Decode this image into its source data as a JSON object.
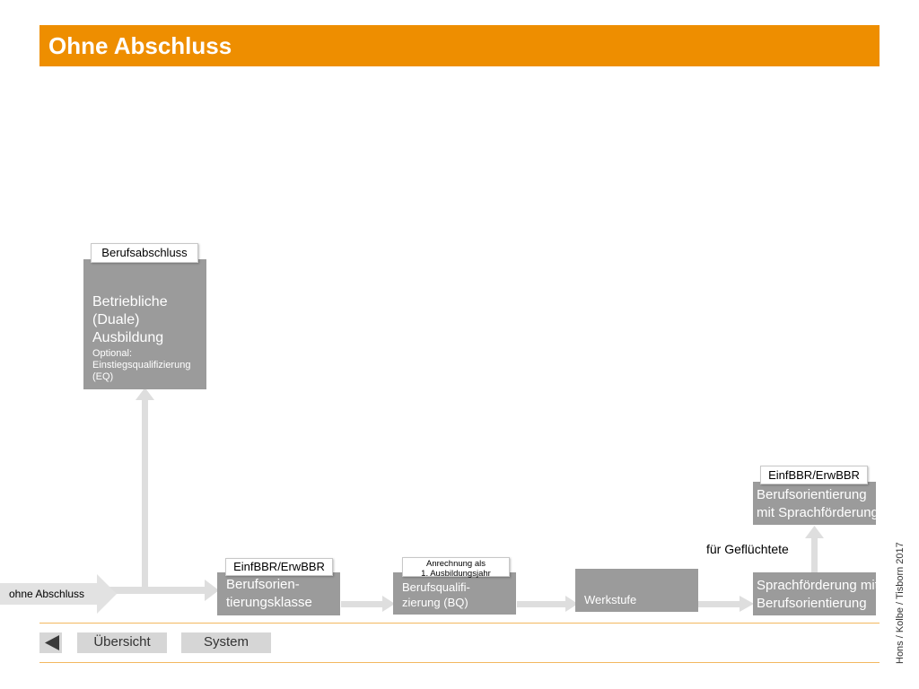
{
  "title": "Ohne Abschluss",
  "left_label": "ohne Abschluss",
  "boxes": {
    "duale": {
      "tag": "Berufsabschluss",
      "title_lines": [
        "Betriebliche",
        "(Duale)",
        "Ausbildung"
      ],
      "note_lines": [
        "Optional:",
        "Einstiegsqualifizierung",
        "(EQ)"
      ]
    },
    "bok": {
      "tag": "EinfBBR/ErwBBR",
      "lines": [
        "Berufsorien-",
        "tierungsklasse"
      ]
    },
    "bq": {
      "tag_lines": [
        "Anrechnung als",
        "1. Ausbildungsjahr"
      ],
      "lines": [
        "Berufsqualifi-",
        "zierung (BQ)"
      ]
    },
    "werkstufe": {
      "label": "Werkstufe"
    },
    "sprach": {
      "lines": [
        "Sprachförderung mit",
        "Berufsorientierung"
      ]
    },
    "bo_sprach": {
      "tag": "EinfBBR/ErwBBR",
      "lines": [
        "Berufsorientierung",
        "mit Sprachförderung"
      ]
    }
  },
  "refugee_label": "für Geflüchtete",
  "nav": {
    "back_icon": "triangle-left-icon",
    "overview": "Übersicht",
    "system": "System"
  },
  "credit": "Hons / Kolbe / Tisborn 2017",
  "colors": {
    "header": "#ee8e00",
    "box": "#9b9b9b",
    "arrow": "#dedede",
    "rule": "#f3b860"
  }
}
